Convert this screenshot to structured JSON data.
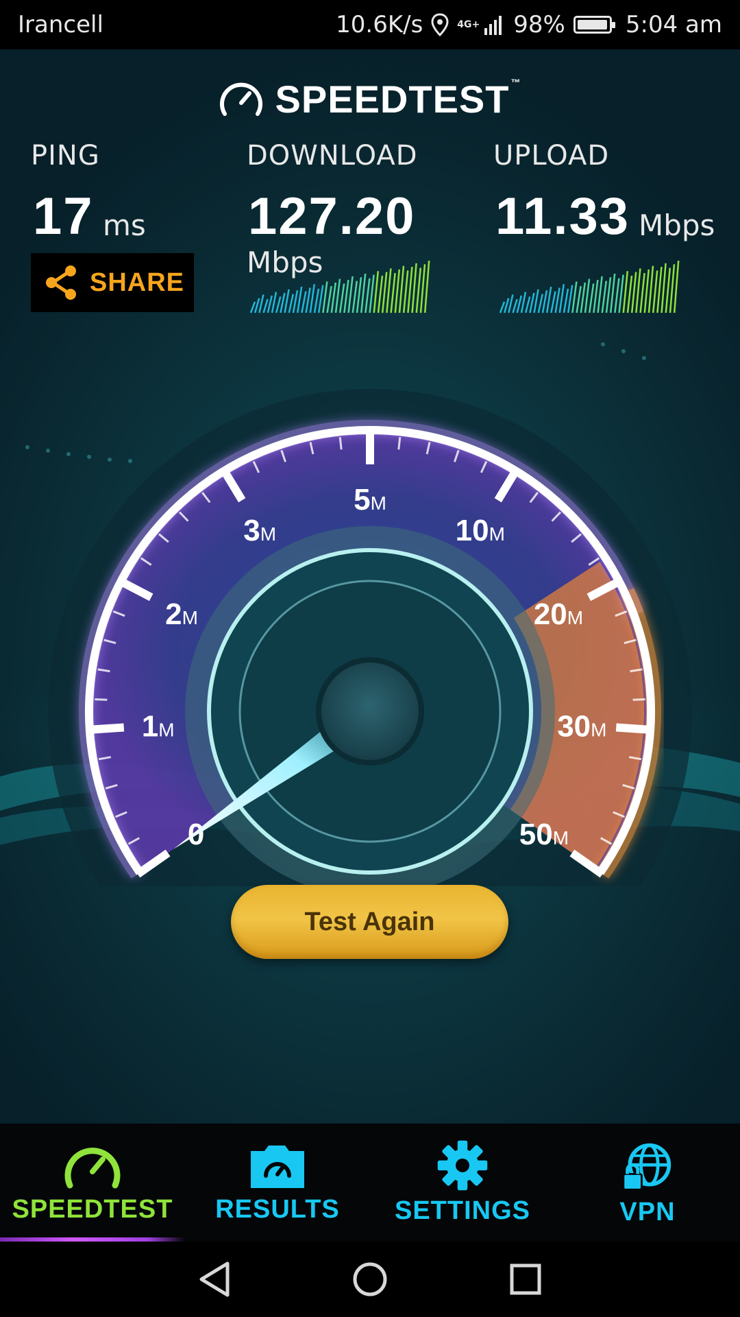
{
  "status_bar": {
    "carrier": "Irancell",
    "speed": "10.6K/s",
    "network": "4G+",
    "battery": "98%",
    "battery_level": 0.98,
    "time": "5:04 am",
    "icons": [
      "location-icon",
      "signal-icon",
      "battery-icon"
    ]
  },
  "app": {
    "logo": "SPEEDTEST",
    "logo_tm": "™"
  },
  "results": {
    "ping": {
      "label": "PING",
      "value": "17",
      "unit": "ms"
    },
    "download": {
      "label": "DOWNLOAD",
      "value": "127.20",
      "unit": "Mbps"
    },
    "upload": {
      "label": "UPLOAD",
      "value": "11.33",
      "unit": "Mbps"
    }
  },
  "share": {
    "label": "SHARE",
    "icon": "share-icon"
  },
  "gauge": {
    "ticks": [
      {
        "num": "0",
        "unit": ""
      },
      {
        "num": "1",
        "unit": "M"
      },
      {
        "num": "2",
        "unit": "M"
      },
      {
        "num": "3",
        "unit": "M"
      },
      {
        "num": "5",
        "unit": "M"
      },
      {
        "num": "10",
        "unit": "M"
      },
      {
        "num": "20",
        "unit": "M"
      },
      {
        "num": "30",
        "unit": "M"
      },
      {
        "num": "50",
        "unit": "M"
      }
    ],
    "needle_value": 0
  },
  "actions": {
    "test_again": "Test Again"
  },
  "tabs": [
    {
      "label": "SPEEDTEST",
      "icon": "speedometer-icon",
      "active": true
    },
    {
      "label": "RESULTS",
      "icon": "results-folder-icon",
      "active": false
    },
    {
      "label": "SETTINGS",
      "icon": "gear-icon",
      "active": false
    },
    {
      "label": "VPN",
      "icon": "globe-lock-icon",
      "active": false
    }
  ],
  "colors": {
    "accent_green": "#8fe33a",
    "accent_cyan": "#18c8f2",
    "share_orange": "#f7a51d",
    "button_gold": "#f1c447",
    "gauge_purple": "#7a5bd0",
    "gauge_orange": "#f08a30"
  }
}
